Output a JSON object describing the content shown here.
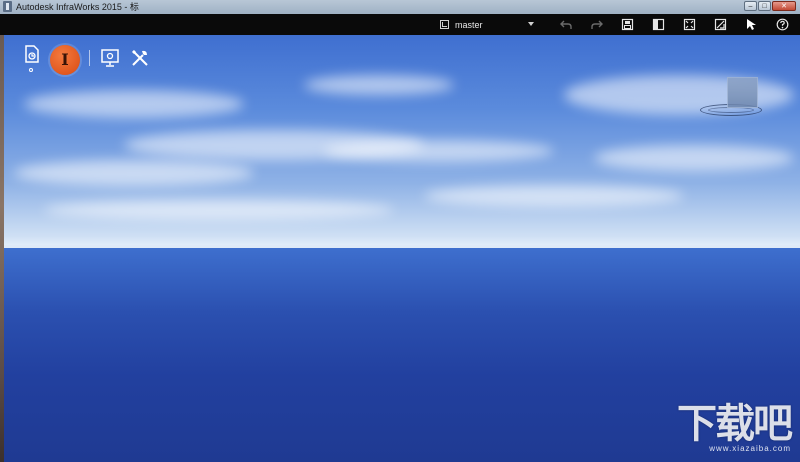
{
  "window": {
    "title": "Autodesk InfraWorks 2015 - 标",
    "buttons": {
      "minimize": "–",
      "maximize": "□",
      "close": "✕"
    }
  },
  "toolbar": {
    "branch_label": "master",
    "icons": [
      "branch-icon",
      "undo-icon",
      "redo-icon",
      "save-view-icon",
      "panel-icon",
      "fit-icon",
      "tile-icon",
      "select-pointer-icon",
      "help-icon"
    ]
  },
  "viewport": {
    "tools": [
      "document-icon",
      "infraworks-logo",
      "presentation-icon",
      "tools-icon"
    ],
    "infra_logo_letter": "I",
    "sky_color": "#5b8bdc",
    "sea_color": "#22409f",
    "accent_color": "#e0541a"
  },
  "watermark": {
    "main": "下载吧",
    "url": "www.xiazaiba.com"
  }
}
